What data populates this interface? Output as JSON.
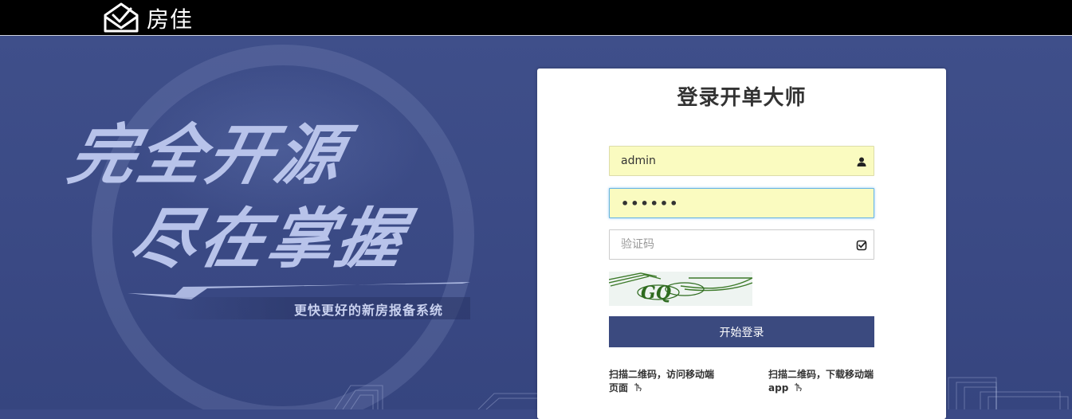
{
  "header": {
    "brand_name": "房佳",
    "logo_icon": "house-check-logo-icon"
  },
  "hero": {
    "slogan_line1": "完全开源",
    "slogan_line2": "尽在掌握",
    "slogan_sub": "更快更好的新房报备系统"
  },
  "login": {
    "title": "登录开单大师",
    "username": {
      "value": "admin",
      "icon": "user-icon"
    },
    "password": {
      "value": "••••••",
      "icon": "none"
    },
    "captcha": {
      "placeholder": "验证码",
      "icon": "check-square-icon",
      "image_text": "GQ"
    },
    "submit_label": "开始登录",
    "qr_mobile_page": "扫描二维码，访问移动端页面",
    "qr_mobile_app": "扫描二维码，下载移动端app",
    "qr_hint_icon": "pointing-hand-icon"
  },
  "colors": {
    "topbar": "#000000",
    "hero_bg": "#3b4a86",
    "button_bg": "#3b4a7f",
    "autofill_bg": "#fafbc0"
  }
}
